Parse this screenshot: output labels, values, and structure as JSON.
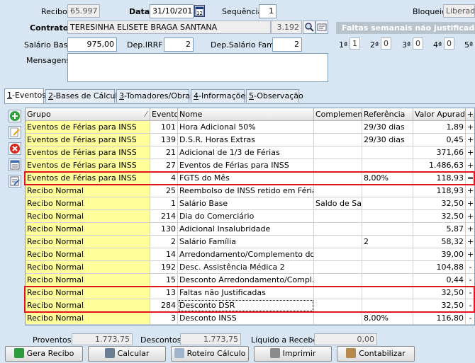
{
  "header": {
    "recibo_label": "Recibo",
    "recibo_value": "65.997",
    "data_label": "Data",
    "data_value": "31/10/2016",
    "sequencia_label": "Sequência",
    "sequencia_value": "1",
    "bloqueio_label": "Bloqueio",
    "bloqueio_value": "Liberado",
    "contrato_label": "Contrato",
    "contrato_name": "TERESINHA ELISETE BRAGA SANTANA",
    "contrato_code": "3.192",
    "salario_label": "Salário Base",
    "salario_value": "975,00",
    "depirrf_label": "Dep.IRRF",
    "depirrf_value": "2",
    "depsal_label": "Dep.Salário Fam.",
    "depsal_value": "2",
    "mensagens_label": "Mensagens",
    "mensagens_value": ""
  },
  "faltas": {
    "title": "Faltas semanais não justificadas",
    "weeks": [
      {
        "label": "1ª",
        "value": "1"
      },
      {
        "label": "2ª",
        "value": "0"
      },
      {
        "label": "3ª",
        "value": "0"
      },
      {
        "label": "4ª",
        "value": "0"
      },
      {
        "label": "5ª",
        "value": ""
      }
    ]
  },
  "tabs": [
    {
      "key": "1",
      "label": "-Eventos"
    },
    {
      "key": "2",
      "label": "-Bases de Cálculo"
    },
    {
      "key": "3",
      "label": "-Tomadores/Obras"
    },
    {
      "key": "4",
      "label": "-Informações"
    },
    {
      "key": "5",
      "label": "-Observação"
    }
  ],
  "grid": {
    "columns": [
      "Grupo",
      "Evento",
      "Nome",
      "Complemento",
      "Referência",
      "Valor Apurado",
      "+/-"
    ],
    "rows": [
      {
        "grupo": "Eventos de Férias para INSS",
        "evento": "101",
        "nome": "Hora Adicional 50%",
        "complemento": "",
        "referencia": "29/30 dias",
        "valor": "1,89",
        "sinal": "+"
      },
      {
        "grupo": "Eventos de Férias para INSS",
        "evento": "139",
        "nome": "D.S.R. Horas Extras",
        "complemento": "",
        "referencia": "29/30 dias",
        "valor": "0,45",
        "sinal": "+"
      },
      {
        "grupo": "Eventos de Férias para INSS",
        "evento": "21",
        "nome": "Adicional de 1/3 de Férias",
        "complemento": "",
        "referencia": "",
        "valor": "371,66",
        "sinal": "+"
      },
      {
        "grupo": "Eventos de Férias para INSS",
        "evento": "27",
        "nome": "Eventos de Férias para INSS",
        "complemento": "",
        "referencia": "",
        "valor": "1.486,63",
        "sinal": "+"
      },
      {
        "grupo": "Eventos de Férias para INSS",
        "evento": "4",
        "nome": "FGTS do Mês",
        "complemento": "",
        "referencia": "8,00%",
        "valor": "118,93",
        "sinal": "="
      },
      {
        "grupo": "Recibo Normal",
        "evento": "25",
        "nome": "Reembolso de INSS retido em Férias",
        "complemento": "",
        "referencia": "",
        "valor": "118,93",
        "sinal": "+"
      },
      {
        "grupo": "Recibo Normal",
        "evento": "1",
        "nome": "Salário Base",
        "complemento": "Saldo de Salário",
        "referencia": "",
        "valor": "32,50",
        "sinal": "+"
      },
      {
        "grupo": "Recibo Normal",
        "evento": "214",
        "nome": "Dia do Comerciário",
        "complemento": "",
        "referencia": "",
        "valor": "32,50",
        "sinal": "+"
      },
      {
        "grupo": "Recibo Normal",
        "evento": "130",
        "nome": "Adicional Insalubridade",
        "complemento": "",
        "referencia": "",
        "valor": "5,87",
        "sinal": "+"
      },
      {
        "grupo": "Recibo Normal",
        "evento": "2",
        "nome": "Salário Família",
        "complemento": "",
        "referencia": "2",
        "valor": "58,32",
        "sinal": "+"
      },
      {
        "grupo": "Recibo Normal",
        "evento": "14",
        "nome": "Arredondamento/Complemento do Mês",
        "complemento": "",
        "referencia": "",
        "valor": "39,00",
        "sinal": "+"
      },
      {
        "grupo": "Recibo Normal",
        "evento": "192",
        "nome": "Desc. Assistência Médica 2",
        "complemento": "",
        "referencia": "",
        "valor": "104,88",
        "sinal": "-"
      },
      {
        "grupo": "Recibo Normal",
        "evento": "15",
        "nome": "Desconto Arredondamento/Compl. Mês",
        "complemento": "",
        "referencia": "",
        "valor": "0,44",
        "sinal": "-"
      },
      {
        "grupo": "Recibo Normal",
        "evento": "13",
        "nome": "Faltas não Justificadas",
        "complemento": "",
        "referencia": "",
        "valor": "32,50",
        "sinal": "-"
      },
      {
        "grupo": "Recibo Normal",
        "evento": "284",
        "nome": "Desconto DSR",
        "complemento": "",
        "referencia": "",
        "valor": "32,50",
        "sinal": "-"
      },
      {
        "grupo": "Recibo Normal",
        "evento": "3",
        "nome": "Desconto INSS",
        "complemento": "",
        "referencia": "8,00%",
        "valor": "116,80",
        "sinal": "-"
      }
    ]
  },
  "totals": {
    "proventos_label": "Proventos",
    "proventos_value": "1.773,75",
    "descontos_label": "Descontos",
    "descontos_value": "1.773,75",
    "liquido_label": "Líquido a Receber",
    "liquido_value": "0,00"
  },
  "buttons": {
    "gera_recibo": "Gera Recibo",
    "calcular": "Calcular",
    "roteiro": "Roteiro Cálculo",
    "imprimir": "Imprimir",
    "contabilizar": "Contabilizar"
  },
  "colors": {
    "highlight": "#e0141e",
    "grupo_bg": "#ffff9c",
    "background": "#d8e6f3"
  }
}
